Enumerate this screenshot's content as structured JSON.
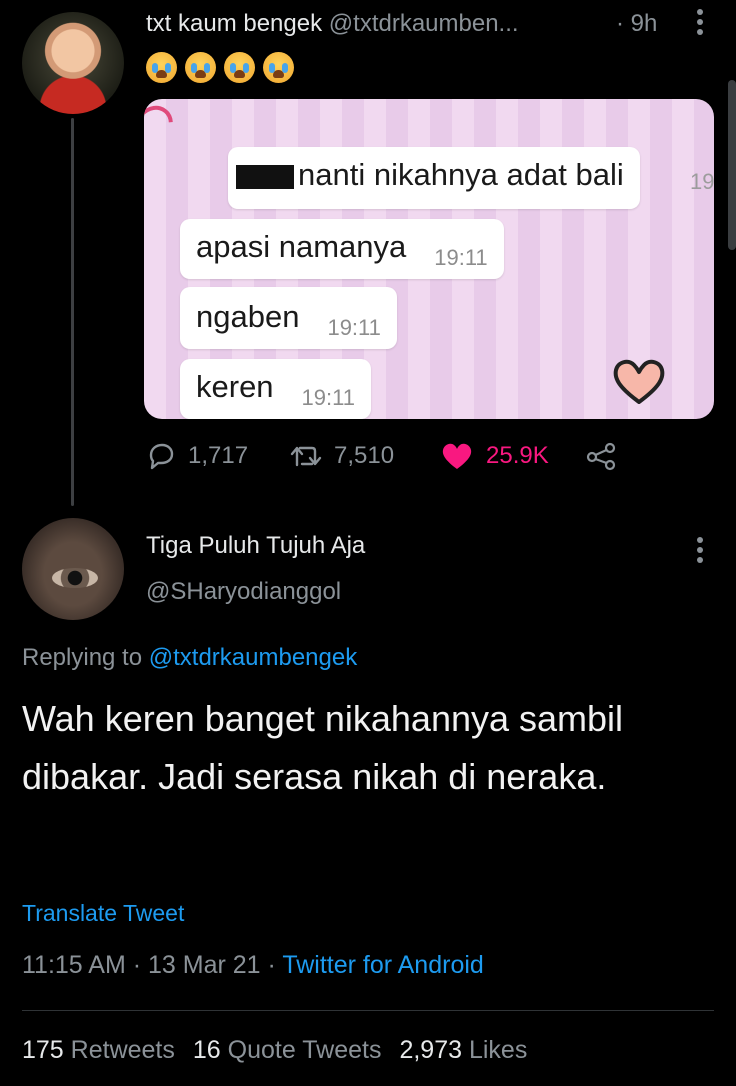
{
  "tweet": {
    "display_name": "txt kaum bengek",
    "handle": "@txtdrkaumben...",
    "time": "· 9h",
    "text_emoji": "😭😭😭😭",
    "media": {
      "messages": [
        {
          "text": "nanti nikahnya adat bali",
          "time": "19"
        },
        {
          "text": "apasi namanya",
          "time": "19:11"
        },
        {
          "text": "ngaben",
          "time": "19:11"
        },
        {
          "text": "keren",
          "time": "19:11"
        }
      ]
    },
    "stats": {
      "replies": "1,717",
      "retweets": "7,510",
      "likes": "25.9K"
    },
    "colors": {
      "like": "#f91880",
      "link": "#1d9bf0",
      "muted": "#8b9298"
    }
  },
  "reply": {
    "display_name": "Tiga Puluh Tujuh Aja",
    "handle": "@SHaryodianggol",
    "replying_prefix": "Replying to ",
    "replying_handle": "@txtdrkaumbengek",
    "text": "Wah keren banget nikahannya sambil dibakar. Jadi serasa nikah di neraka.",
    "translate": "Translate Tweet",
    "timestamp": "11:15 AM · 13 Mar 21 · ",
    "source": "Twitter for Android",
    "counts": {
      "retweets": "175",
      "retweets_label": " Retweets",
      "quotes": "16",
      "quotes_label": " Quote Tweets",
      "likes": "2,973",
      "likes_label": " Likes"
    }
  },
  "icons": [
    "more-vertical-icon",
    "reply-icon",
    "retweet-icon",
    "heart-icon",
    "share-icon",
    "loudly-crying-face-emoji",
    "heart-sticker-icon"
  ]
}
